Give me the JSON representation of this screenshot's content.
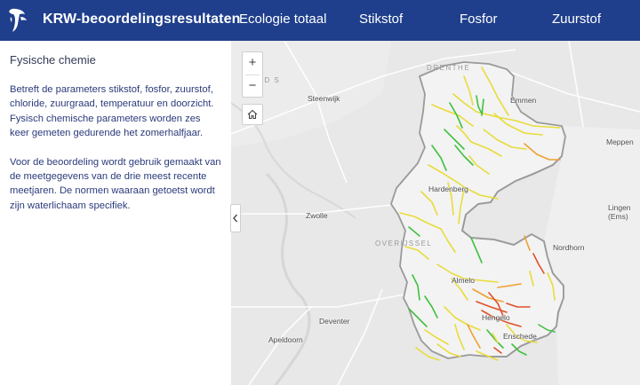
{
  "header": {
    "app_title": "KRW-beoordelingsresultaten",
    "tabs": [
      "Ecologie totaal",
      "Stikstof",
      "Fosfor",
      "Zuurstof"
    ],
    "background": "#1f3f8c"
  },
  "panel": {
    "title": "Fysische chemie",
    "paragraphs": [
      "Betreft de parameters stikstof, fosfor, zuurstof, chloride, zuurgraad, temperatuur en doorzicht. Fysisch chemische parameters worden zes keer gemeten gedurende het zomerhalfjaar.",
      "Voor de beoordeling wordt gebruik gemaakt van de meetgegevens van de drie meest recente meetjaren. De normen waaraan getoetst wordt zijn waterlichaam specifiek."
    ]
  },
  "map": {
    "controls": {
      "zoom_in": "+",
      "zoom_out": "−",
      "home_icon": "home-icon",
      "collapse_icon": "chevron-left-icon"
    },
    "places": [
      "Emmen",
      "Steenwijk",
      "Meppen",
      "Hardenberg",
      "Zwolle",
      "Lingen (Ems)",
      "Nordhorn",
      "Almelo",
      "Hengelo",
      "Deventer",
      "Enschede",
      "Apeldoorn"
    ],
    "regions": [
      "DRENTHE",
      "OVERIJSSEL"
    ],
    "partial_label": "L D S",
    "legend_colors": {
      "good": "#3fc13f",
      "moderate": "#e8dc3a",
      "poor": "#f0a030",
      "bad": "#e0502a"
    }
  }
}
